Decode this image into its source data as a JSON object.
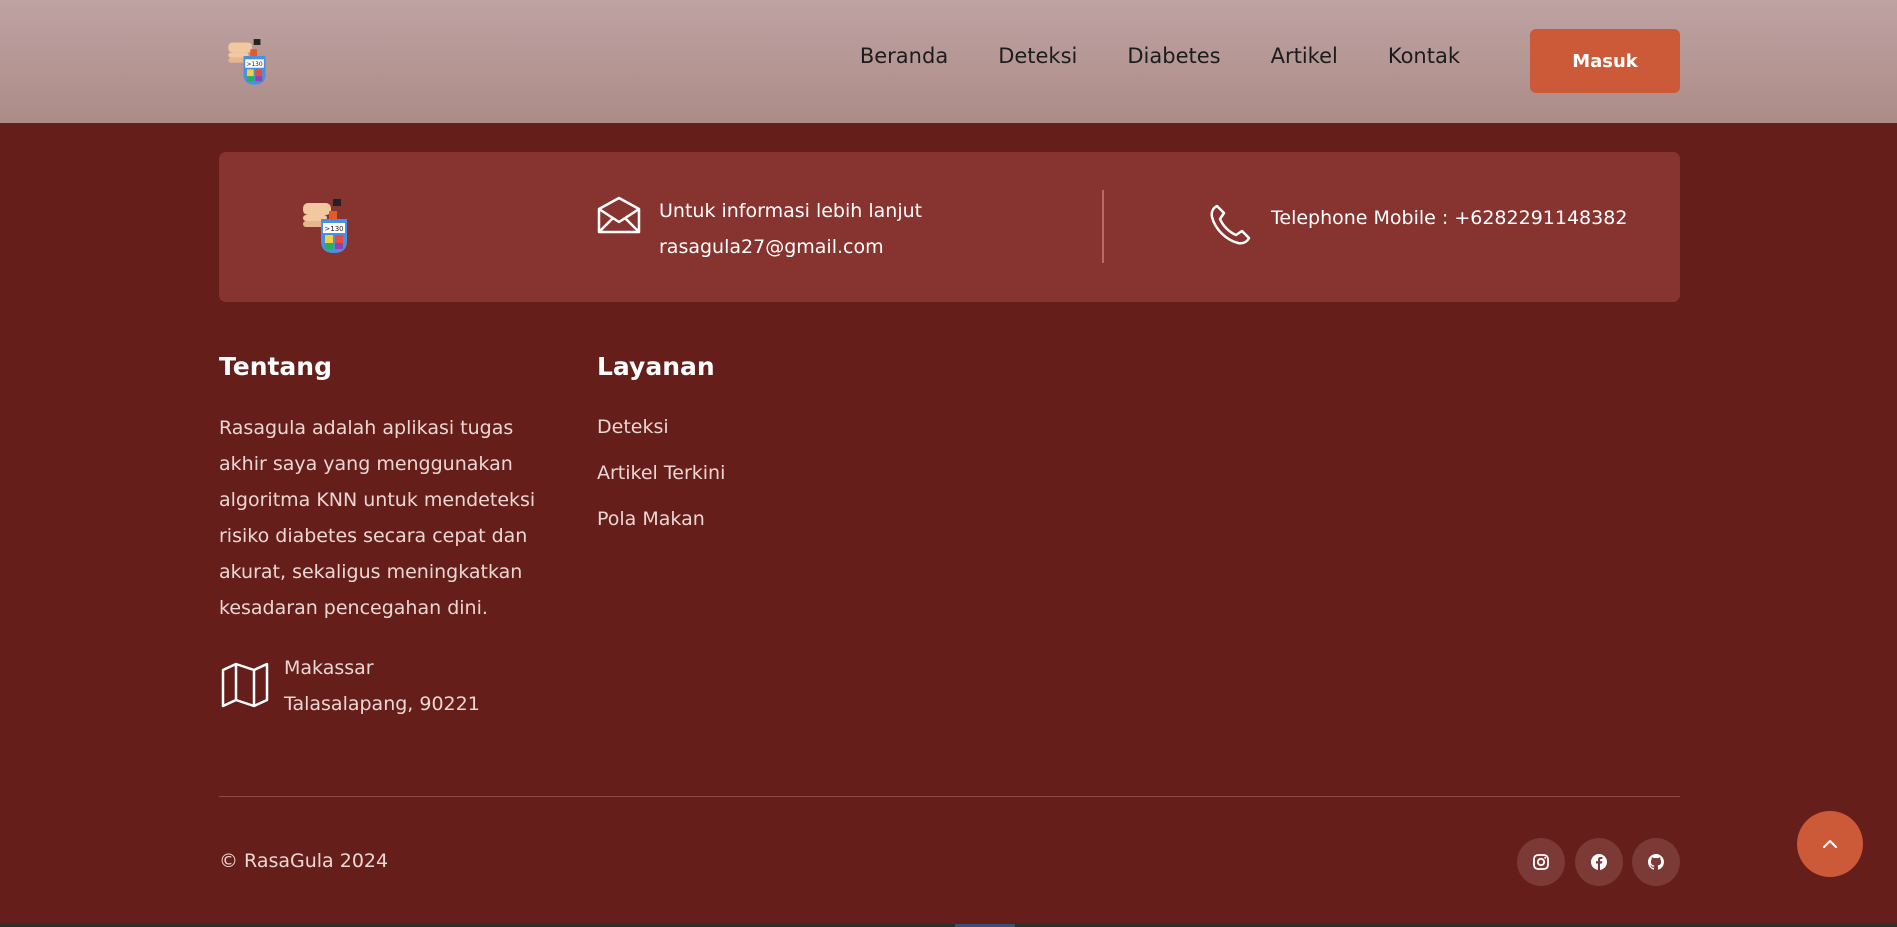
{
  "header": {
    "logo_icon": "glucose-meter-logo",
    "nav": [
      "Beranda",
      "Deteksi",
      "Diabetes",
      "Artikel",
      "Kontak"
    ],
    "login_label": "Masuk"
  },
  "info": {
    "mail_line1": "Untuk informasi lebih lanjut",
    "mail_line2": "rasagula27@gmail.com",
    "phone": "Telephone Mobile : +6282291148382"
  },
  "footer": {
    "about": {
      "title": "Tentang",
      "lines": [
        "Rasagula adalah aplikasi tugas",
        "akhir saya yang menggunakan",
        "algoritma KNN untuk mendeteksi",
        "risiko diabetes secara cepat dan",
        "akurat, sekaligus meningkatkan",
        "kesadaran pencegahan dini."
      ],
      "city": "Makassar",
      "area": "Talasalapang, 90221"
    },
    "services": {
      "title": "Layanan",
      "items": [
        "Deteksi",
        "Artikel Terkini",
        "Pola Makan"
      ]
    },
    "copyright": "© RasaGula 2024",
    "social_icons": [
      "instagram-icon",
      "facebook-icon",
      "github-icon"
    ]
  },
  "colors": {
    "background": "#661e1a",
    "info_box": "#873430",
    "accent": "#cc5937"
  }
}
